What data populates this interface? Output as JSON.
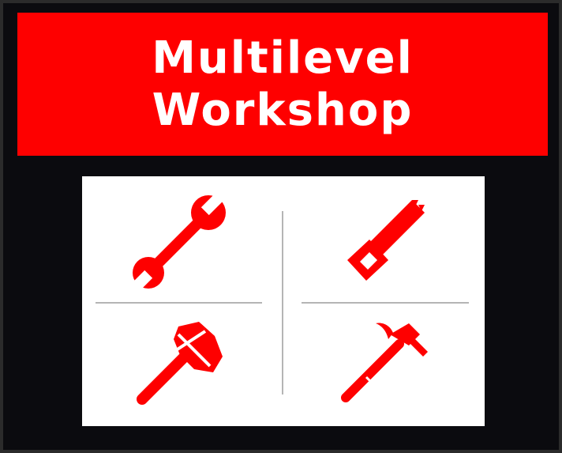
{
  "banner": {
    "title_line1": "Multilevel",
    "title_line2": "Workshop"
  },
  "tools": [
    {
      "icon": "wrench-icon"
    },
    {
      "icon": "saw-icon"
    },
    {
      "icon": "stone-hammer-icon"
    },
    {
      "icon": "claw-hammer-icon"
    }
  ],
  "colors": {
    "accent": "#fe0000",
    "background": "#0b0b0f",
    "panel": "#ffffff",
    "text": "#ffffff"
  }
}
